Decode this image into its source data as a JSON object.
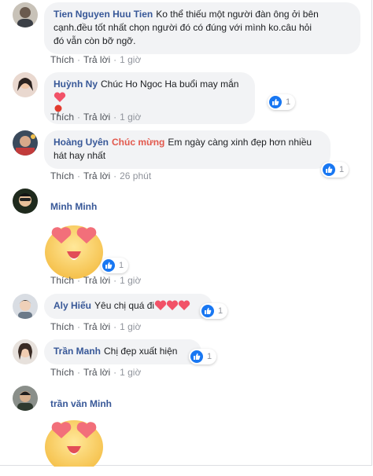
{
  "comments": [
    {
      "name": "Tien Nguyen Huu Tien",
      "text_lines": [
        "Ko thể thiếu một người đàn ông ởi bên",
        "cạnh.đều tốt nhất chọn người đó có đúng với mình ko.câu hỏi",
        "đó vẫn còn bỡ ngỡ."
      ],
      "actions": {
        "like": "Thích",
        "reply": "Trả lời",
        "time": "1 giờ"
      }
    },
    {
      "name": "Huỳnh Ny",
      "text": "Chúc Ho Ngoc Ha buổi may mắn",
      "reactions": "1",
      "actions": {
        "like": "Thích",
        "reply": "Trả lời",
        "time": "1 giờ"
      }
    },
    {
      "name": "Hoàng Uyên",
      "tag": "Chúc mừng",
      "text_lines": [
        "Em ngày càng xinh đẹp hơn nhiều",
        "hát hay nhất"
      ],
      "reactions": "1",
      "actions": {
        "like": "Thích",
        "reply": "Trả lời",
        "time": "26 phút"
      }
    },
    {
      "name": "Minh Minh",
      "reactions": "1",
      "actions": {
        "like": "Thích",
        "reply": "Trả lời",
        "time": "1 giờ"
      }
    },
    {
      "name": "Aly Hiếu",
      "text": "Yêu chị quá đi",
      "reactions": "1",
      "actions": {
        "like": "Thích",
        "reply": "Trả lời",
        "time": "1 giờ"
      }
    },
    {
      "name": "Trần Manh",
      "text": "Chị đẹp xuất hiện",
      "reactions": "1",
      "actions": {
        "like": "Thích",
        "reply": "Trả lời",
        "time": "1 giờ"
      }
    },
    {
      "name": "trần văn Minh"
    }
  ],
  "separator": "·",
  "colors": {
    "link": "#385898",
    "tag": "#e2584c",
    "bubble": "#f2f3f5",
    "like": "#1877f2",
    "heart": "#f25268"
  },
  "icons": {
    "like": "thumbs-up-icon",
    "heart": "heart-icon",
    "sticker": "heart-eyes-emoji-sticker",
    "pin": "pushpin-icon"
  }
}
